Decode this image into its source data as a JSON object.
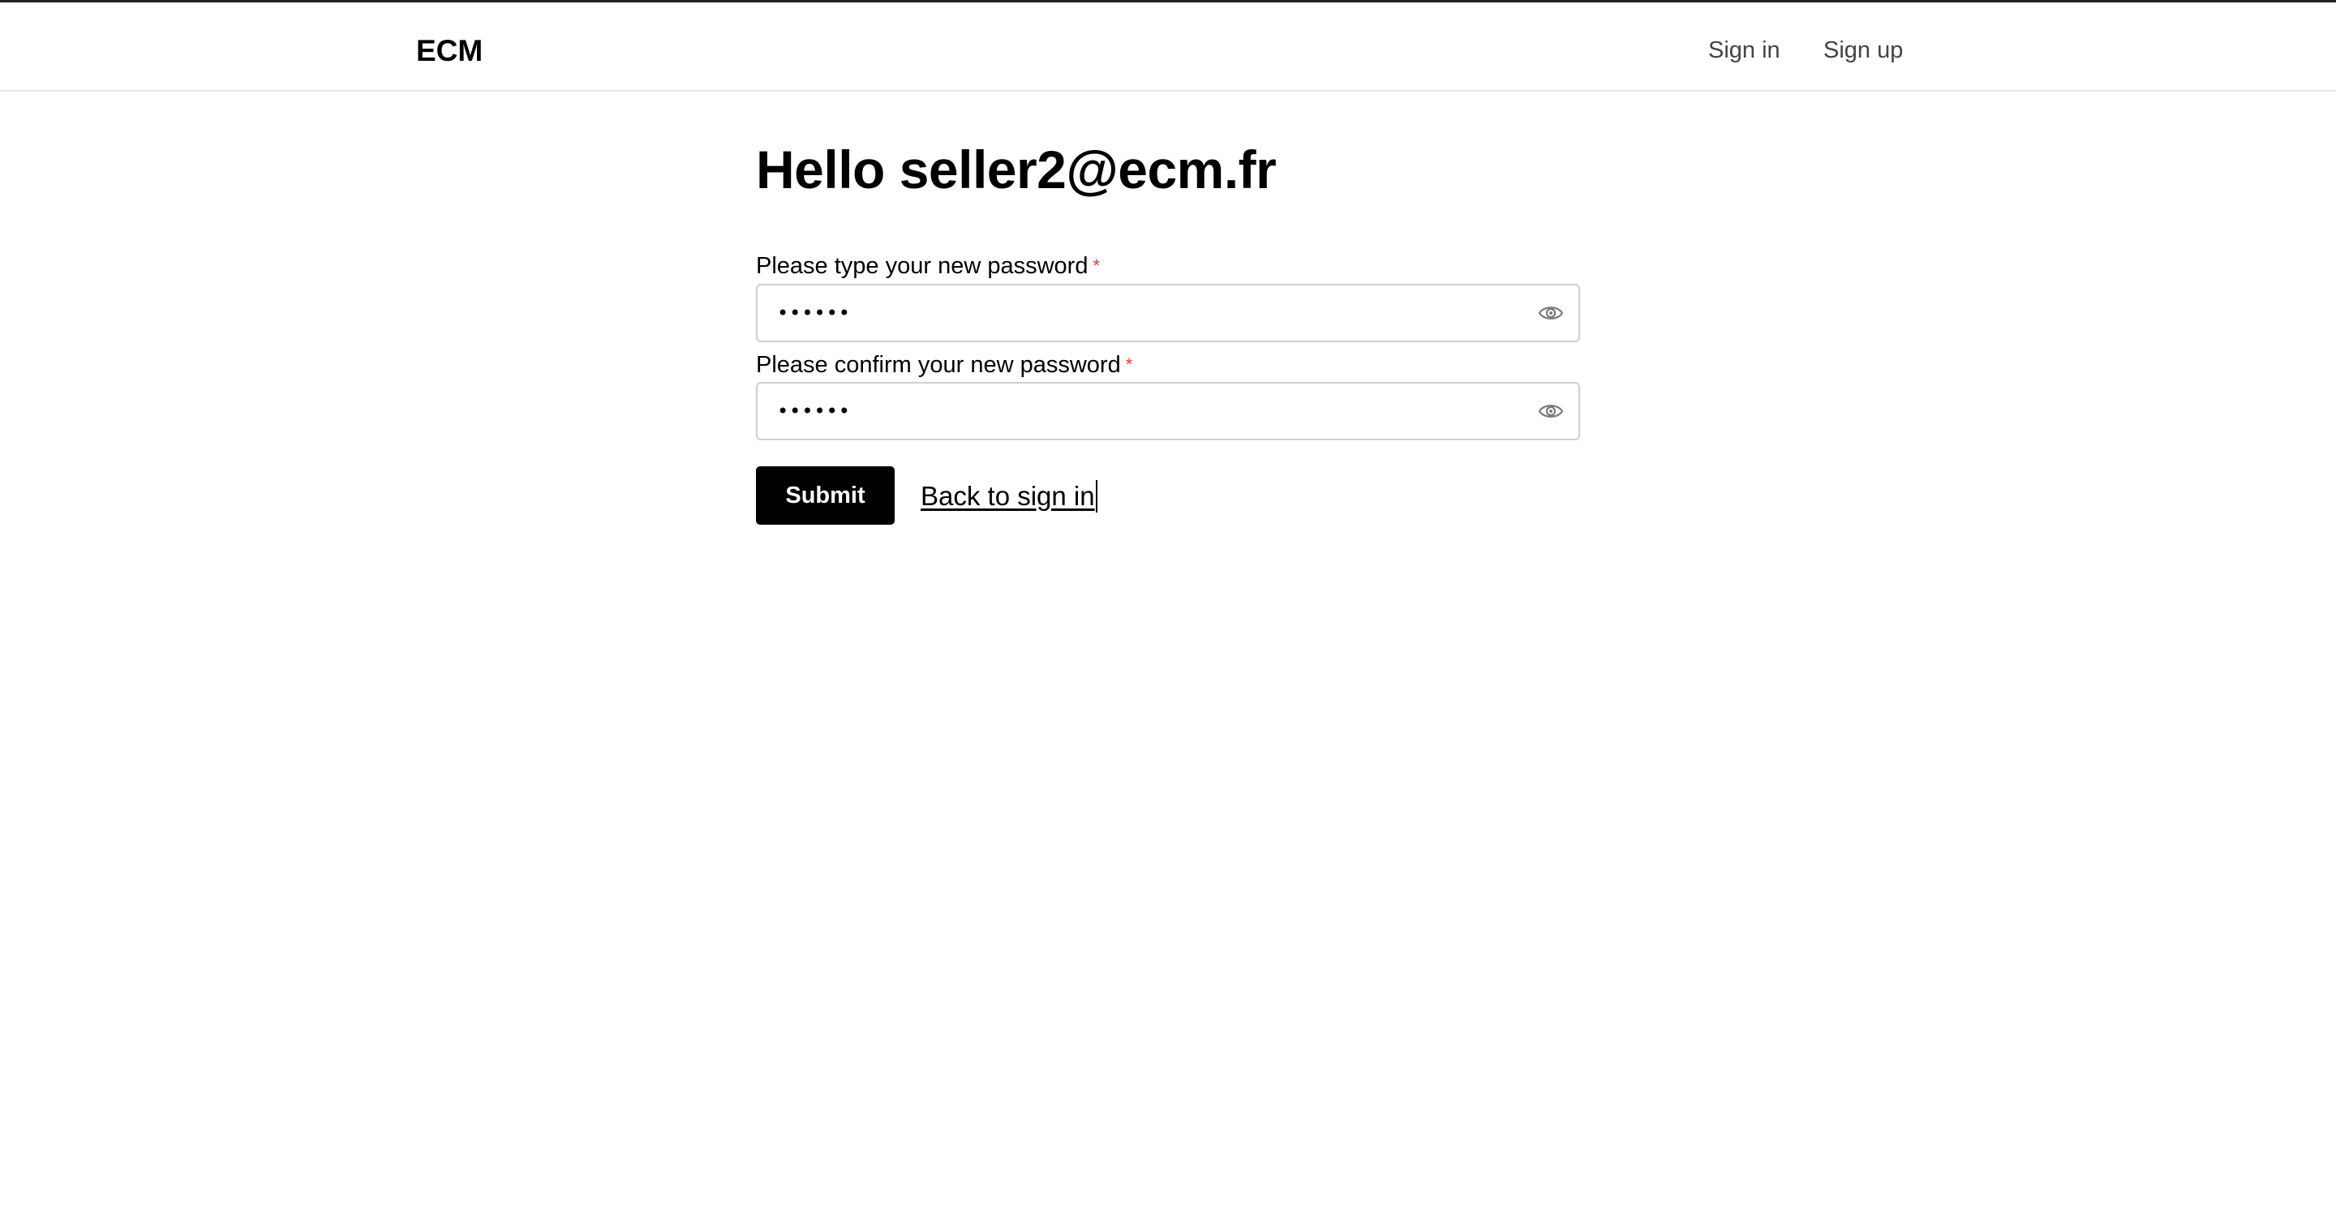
{
  "header": {
    "brand": "ECM",
    "nav": {
      "sign_in": "Sign in",
      "sign_up": "Sign up"
    }
  },
  "main": {
    "title": "Hello seller2@ecm.fr",
    "fields": {
      "new_password": {
        "label": "Please type your new password",
        "required_mark": "*",
        "value": "••••••",
        "icon": "eye-icon"
      },
      "confirm_password": {
        "label": "Please confirm your new password",
        "required_mark": "*",
        "value": "••••••",
        "icon": "eye-icon"
      }
    },
    "actions": {
      "submit_label": "Submit",
      "back_label": "Back to sign in"
    }
  },
  "colors": {
    "primary_button": "#000000",
    "required": "#e53935",
    "nav_text": "#444444",
    "input_border": "#cfcfcf"
  }
}
